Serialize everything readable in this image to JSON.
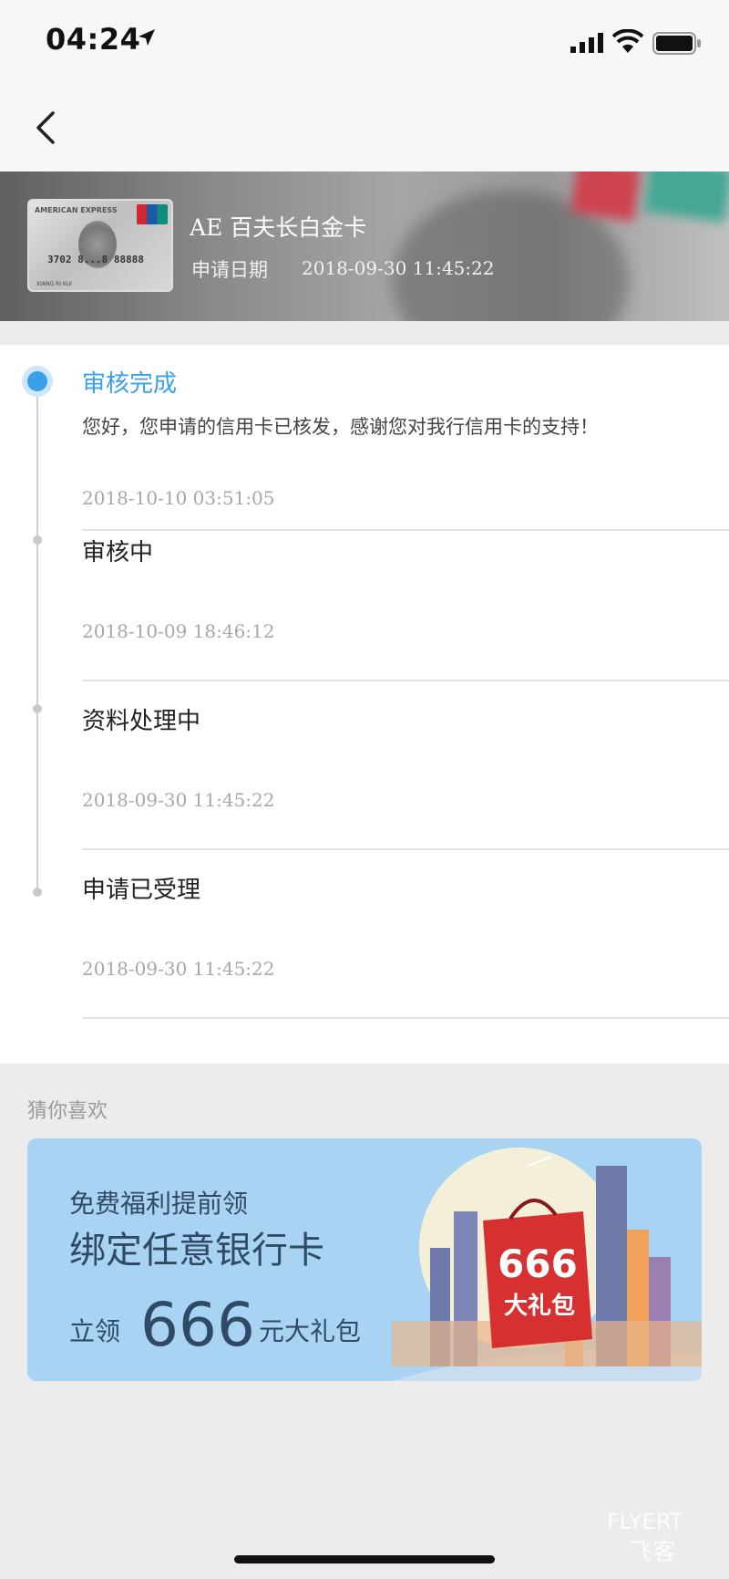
{
  "status_bar": {
    "time": "04:24"
  },
  "card": {
    "title": "AE 百夫长白金卡",
    "date_label": "申请日期",
    "date_value": "2018-09-30 11:45:22",
    "card_brand": "AMERICAN EXPRESS",
    "card_number": "3702 8...8 88888",
    "card_name": "XIANG RI KUI"
  },
  "timeline": [
    {
      "title": "审核完成",
      "desc": "您好，您申请的信用卡已核发，感谢您对我行信用卡的支持！",
      "time": "2018-10-10 03:51:05",
      "active": true
    },
    {
      "title": "审核中",
      "desc": "",
      "time": "2018-10-09 18:46:12",
      "active": false
    },
    {
      "title": "资料处理中",
      "desc": "",
      "time": "2018-09-30 11:45:22",
      "active": false
    },
    {
      "title": "申请已受理",
      "desc": "",
      "time": "2018-09-30 11:45:22",
      "active": false
    }
  ],
  "recommend": {
    "label": "猜你喜欢",
    "banner": {
      "line1": "免费福利提前领",
      "line2": "绑定任意银行卡",
      "pre": "立领",
      "num": "666",
      "post": "元大礼包",
      "bag_num": "666",
      "bag_text": "大礼包"
    }
  },
  "watermark": {
    "line1": "FLYERT",
    "line2": "飞客"
  },
  "colors": {
    "accent": "#3ba0ec",
    "banner_bg": "#a9d3f3",
    "bag_red": "#d63030"
  }
}
